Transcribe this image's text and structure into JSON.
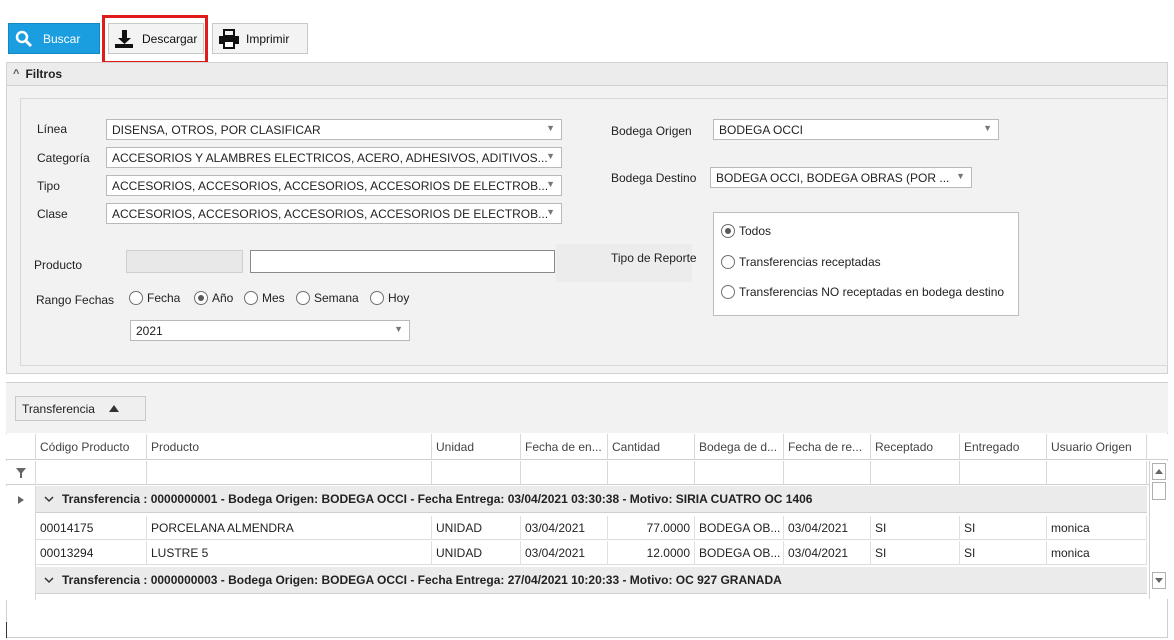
{
  "toolbar": {
    "buscar_label": "Buscar",
    "descargar_label": "Descargar",
    "imprimir_label": "Imprimir",
    "accent_color": "#1a9ee0",
    "highlight_color": "#e01b1b"
  },
  "filters": {
    "header": "Filtros",
    "linea_label": "Línea",
    "linea_value": "DISENSA, OTROS, POR CLASIFICAR",
    "categoria_label": "Categoría",
    "categoria_value": "ACCESORIOS Y ALAMBRES ELECTRICOS, ACERO, ADHESIVOS, ADITIVOS...",
    "tipo_label": "Tipo",
    "tipo_value": "ACCESORIOS, ACCESORIOS, ACCESORIOS, ACCESORIOS DE ELECTROB...",
    "clase_label": "Clase",
    "clase_value": "ACCESORIOS, ACCESORIOS, ACCESORIOS, ACCESORIOS DE ELECTROB...",
    "bodega_origen_label": "Bodega Origen",
    "bodega_origen_value": "BODEGA OCCI",
    "bodega_destino_label": "Bodega Destino",
    "bodega_destino_value": "BODEGA OCCI, BODEGA OBRAS (POR ...",
    "producto_label": "Producto",
    "producto_code": "",
    "producto_name": "",
    "rango_label": "Rango Fechas",
    "rango_options": [
      "Fecha",
      "Año",
      "Mes",
      "Semana",
      "Hoy"
    ],
    "rango_selected": "Año",
    "year_value": "2021",
    "tipo_reporte_label": "Tipo de Reporte",
    "reporte_options": [
      "Todos",
      "Transferencias receptadas",
      "Transferencias NO receptadas en bodega destino"
    ],
    "reporte_selected": "Todos"
  },
  "grid": {
    "group_chip": "Transferencia",
    "columns": [
      "Código Producto",
      "Producto",
      "Unidad",
      "Fecha de en...",
      "Cantidad",
      "Bodega de d...",
      "Fecha de re...",
      "Receptado",
      "Entregado",
      "Usuario Origen"
    ],
    "groups": [
      {
        "label": "Transferencia : 0000000001 - Bodega Origen: BODEGA OCCI - Fecha Entrega: 03/04/2021 03:30:38 - Motivo: SIRIA CUATRO OC 1406",
        "rows": [
          [
            "00014175",
            "PORCELANA ALMENDRA",
            "UNIDAD",
            "03/04/2021",
            "77.0000",
            "BODEGA OB...",
            "03/04/2021",
            "SI",
            "SI",
            "monica"
          ],
          [
            "00013294",
            "LUSTRE 5",
            "UNIDAD",
            "03/04/2021",
            "12.0000",
            "BODEGA OB...",
            "03/04/2021",
            "SI",
            "SI",
            "monica"
          ]
        ]
      },
      {
        "label": "Transferencia : 0000000003 - Bodega Origen: BODEGA OCCI - Fecha Entrega: 27/04/2021 10:20:33 - Motivo: OC 927 GRANADA",
        "rows": []
      }
    ]
  }
}
